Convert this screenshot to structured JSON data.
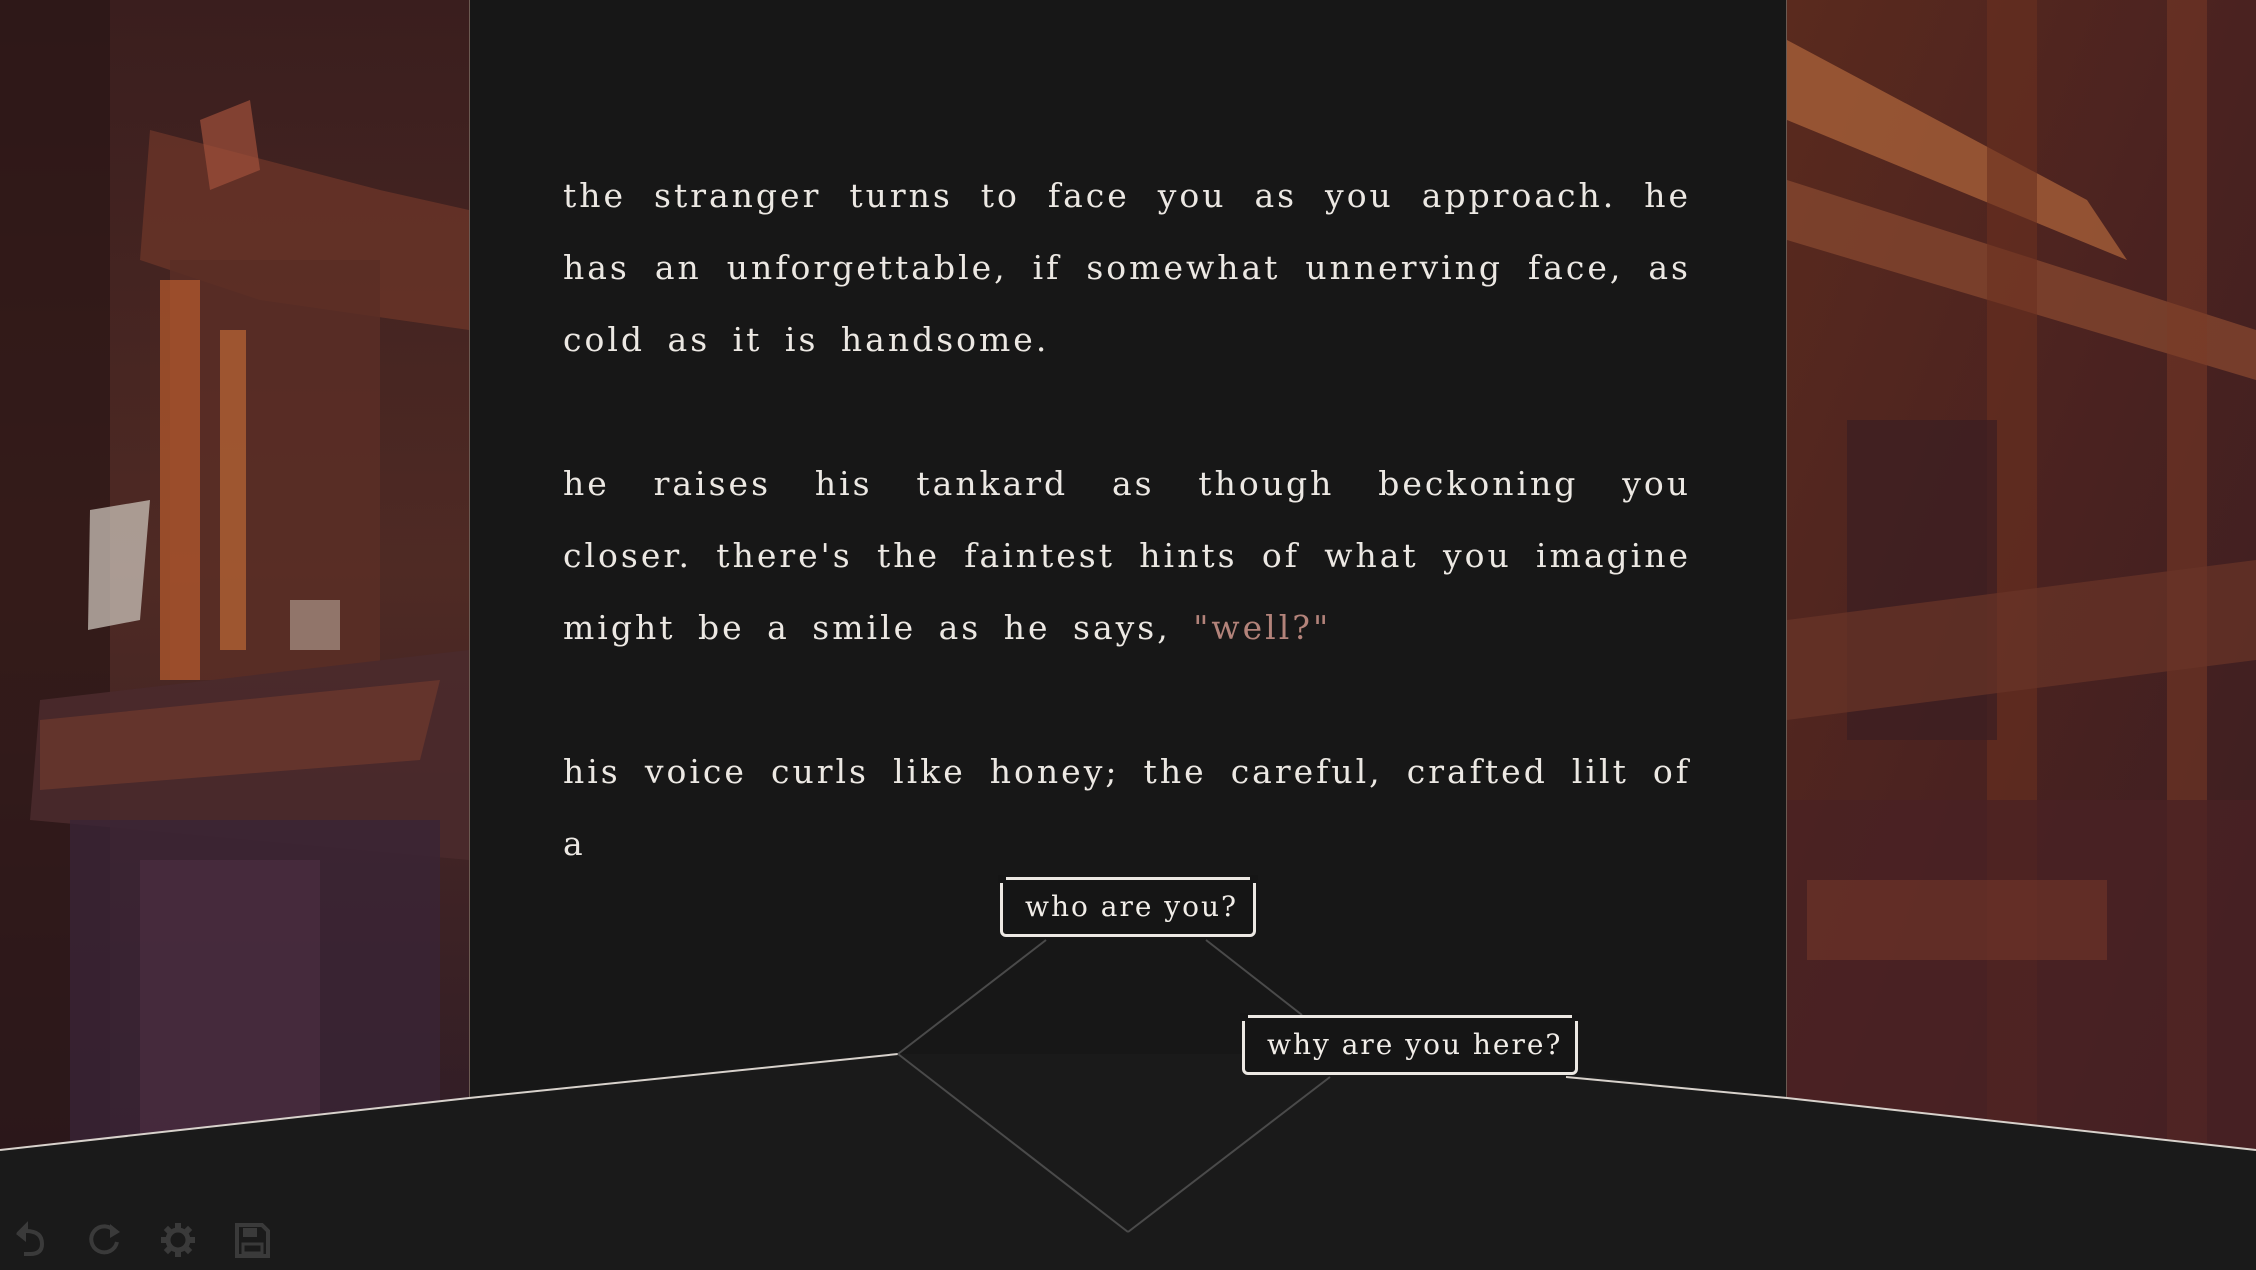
{
  "story": {
    "paragraph_1": "the stranger turns to face you as you approach. he has an unforgettable, if somewhat unnerving face, as cold as it is handsome.",
    "paragraph_2_lead": "he raises his tankard as though beckoning you closer. there's the faintest hints of what you imagine might be a smile as he says, ",
    "paragraph_2_quote": "\"well?\"",
    "paragraph_3": "his voice curls like honey; the careful, crafted lilt of a"
  },
  "choices": {
    "who": "who are you?",
    "why": "why are you here?"
  },
  "toolbar": {
    "icons": [
      "undo-icon",
      "redo-icon",
      "settings-gear-icon",
      "save-icon"
    ]
  },
  "colors": {
    "background": "#181818",
    "text": "#ece8e3",
    "quote": "#b3837a",
    "panel_border": "#6b5a52",
    "toolbar_icon": "#3a3a3a"
  }
}
